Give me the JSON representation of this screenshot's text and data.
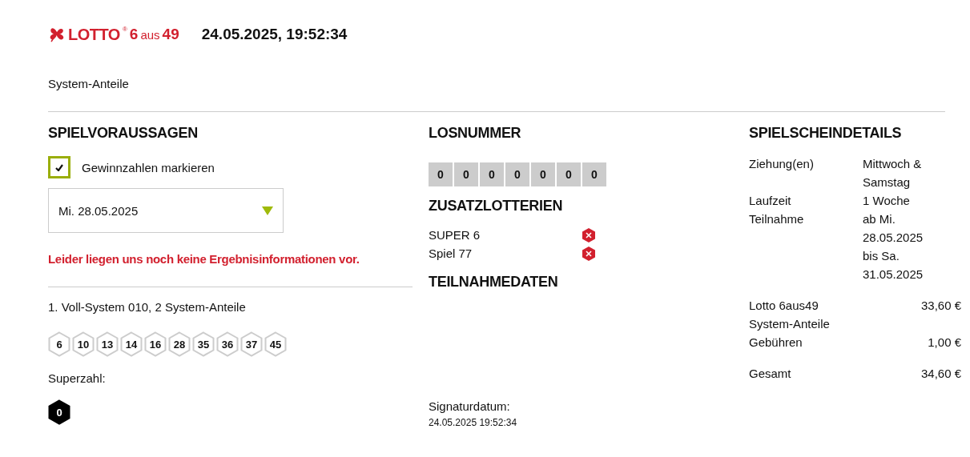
{
  "header": {
    "logo": {
      "brand": "LOTTO",
      "registered": "®",
      "six": "6",
      "aus": "aus",
      "fortynine": "49"
    },
    "timestamp": "24.05.2025, 19:52:34"
  },
  "subtitle": "System-Anteile",
  "predictions": {
    "title": "SPIELVORAUSSAGEN",
    "checkbox": {
      "label": "Gewinnzahlen markieren",
      "checked": true
    },
    "dropdown": {
      "value": "Mi. 28.05.2025"
    },
    "error": "Leider liegen uns noch keine Ergebnisinformationen vor.",
    "system_title": "1. Voll-System 010, 2 System-Anteile",
    "numbers": [
      "6",
      "10",
      "13",
      "14",
      "16",
      "28",
      "35",
      "36",
      "37",
      "45"
    ],
    "superzahl_label": "Superzahl:",
    "superzahl": "0"
  },
  "ticket_number": {
    "title": "LOSNUMMER",
    "digits": [
      "0",
      "0",
      "0",
      "0",
      "0",
      "0",
      "0"
    ]
  },
  "extra_lotteries": {
    "title": "ZUSATZLOTTERIEN",
    "items": [
      {
        "name": "SUPER 6",
        "participating": false
      },
      {
        "name": "Spiel 77",
        "participating": false
      }
    ]
  },
  "participation": {
    "title": "TEILNAHMEDATEN",
    "signature_label": "Signaturdatum:",
    "signature_date": "24.05.2025 19:52:34"
  },
  "details": {
    "title": "SPIELSCHEINDETAILS",
    "info": [
      {
        "label": "Ziehung(en)",
        "value": "Mittwoch & Samstag"
      },
      {
        "label": "Laufzeit",
        "value": "1 Woche"
      },
      {
        "label": "Teilnahme",
        "value": "ab Mi. 28.05.2025 bis Sa. 31.05.2025"
      }
    ],
    "costs": [
      {
        "label": "Lotto 6aus49 System-Anteile",
        "amount": "33,60 €"
      },
      {
        "label": "Gebühren",
        "amount": "1,00 €"
      }
    ],
    "total": {
      "label": "Gesamt",
      "amount": "34,60 €"
    }
  }
}
